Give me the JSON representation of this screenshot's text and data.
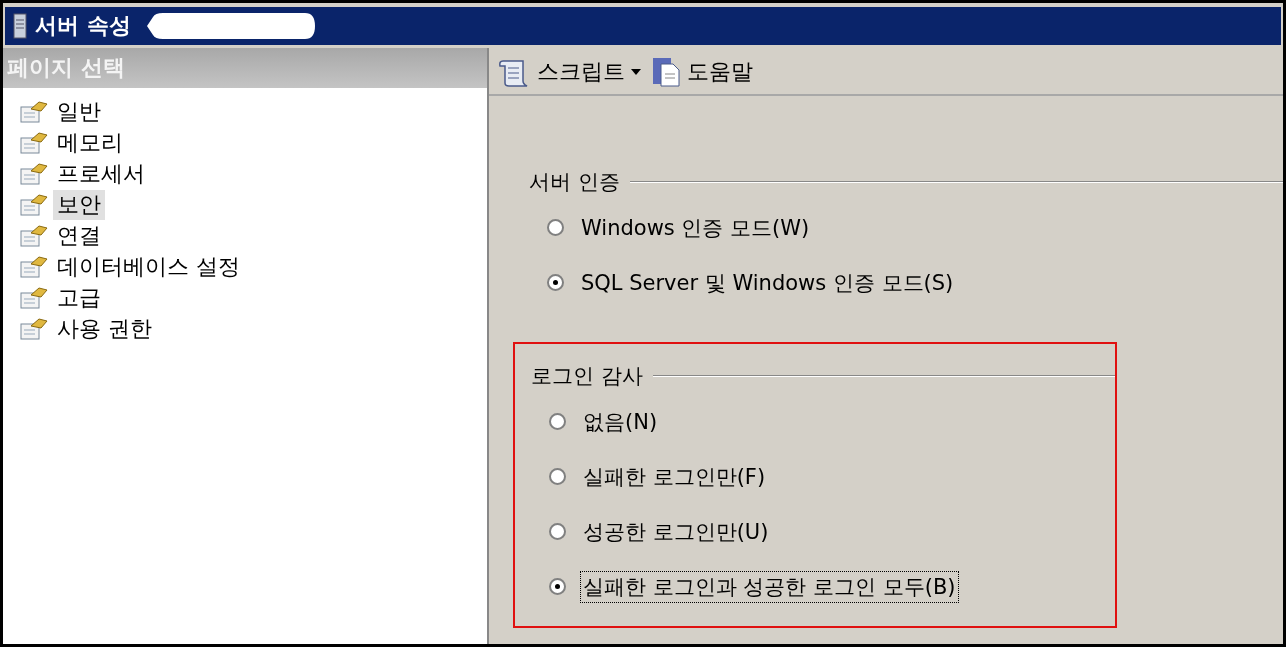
{
  "window": {
    "title": "서버 속성"
  },
  "sidebar": {
    "header": "페이지 선택",
    "items": [
      {
        "label": "일반",
        "selected": false
      },
      {
        "label": "메모리",
        "selected": false
      },
      {
        "label": "프로세서",
        "selected": false
      },
      {
        "label": "보안",
        "selected": true
      },
      {
        "label": "연결",
        "selected": false
      },
      {
        "label": "데이터베이스 설정",
        "selected": false
      },
      {
        "label": "고급",
        "selected": false
      },
      {
        "label": "사용 권한",
        "selected": false
      }
    ]
  },
  "toolbar": {
    "script": "스크립트",
    "help": "도움말"
  },
  "sections": [
    {
      "title": "서버 인증",
      "highlighted": false,
      "options": [
        {
          "label": "Windows 인증 모드(W)",
          "selected": false,
          "focused": false
        },
        {
          "label": "SQL Server 및 Windows 인증 모드(S)",
          "selected": true,
          "focused": false
        }
      ]
    },
    {
      "title": "로그인 감사",
      "highlighted": true,
      "options": [
        {
          "label": "없음(N)",
          "selected": false,
          "focused": false
        },
        {
          "label": "실패한 로그인만(F)",
          "selected": false,
          "focused": false
        },
        {
          "label": "성공한 로그인만(U)",
          "selected": false,
          "focused": false
        },
        {
          "label": "실패한 로그인과 성공한 로그인 모두(B)",
          "selected": true,
          "focused": true
        }
      ]
    }
  ]
}
